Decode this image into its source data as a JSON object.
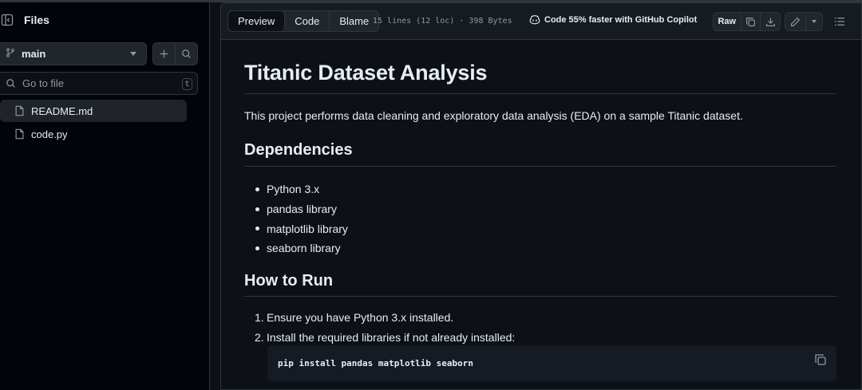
{
  "sidebar": {
    "title": "Files",
    "branch": "main",
    "search_placeholder": "Go to file",
    "search_shortcut": "t",
    "files": [
      {
        "name": "README.md",
        "active": true
      },
      {
        "name": "code.py",
        "active": false
      }
    ]
  },
  "toolbar": {
    "tabs": [
      "Preview",
      "Code",
      "Blame"
    ],
    "active_tab": "Preview",
    "meta": "15 lines (12 loc) · 398 Bytes",
    "copilot": "Code 55% faster with GitHub Copilot",
    "raw_label": "Raw"
  },
  "readme": {
    "title": "Titanic Dataset Analysis",
    "intro": "This project performs data cleaning and exploratory data analysis (EDA) on a sample Titanic dataset.",
    "dependencies_heading": "Dependencies",
    "dependencies": [
      "Python 3.x",
      "pandas library",
      "matplotlib library",
      "seaborn library"
    ],
    "howto_heading": "How to Run",
    "steps": [
      {
        "num": "1.",
        "text": "Ensure you have Python 3.x installed."
      },
      {
        "num": "2.",
        "text": "Install the required libraries if not already installed:"
      }
    ],
    "code": "pip install pandas matplotlib seaborn"
  },
  "colors": {
    "background": "#0d1117",
    "sidebar": "#010409",
    "border": "#30363d",
    "text": "#e6edf3",
    "muted": "#9198a1"
  }
}
